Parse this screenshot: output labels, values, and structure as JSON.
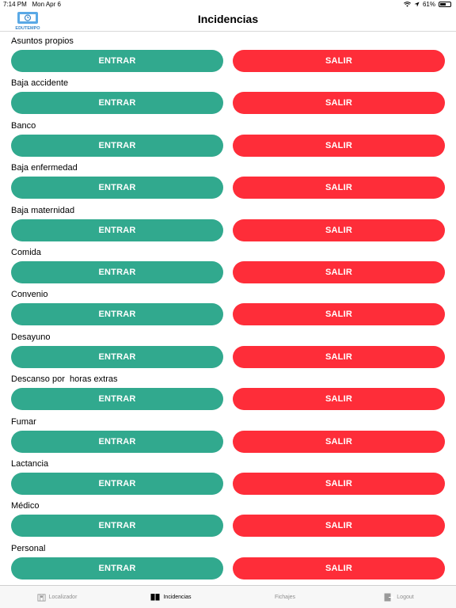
{
  "status_bar": {
    "time": "7:14 PM",
    "date": "Mon Apr 6",
    "battery": "61%",
    "battery_level": 0.61
  },
  "nav": {
    "title": "Incidencias",
    "logo_text": "EDUTEMPO"
  },
  "colors": {
    "entrar": "#31a98e",
    "salir": "#fe2d39"
  },
  "incidencias": [
    {
      "label": "Asuntos propios",
      "entrar": "ENTRAR",
      "salir": "SALIR"
    },
    {
      "label": "Baja accidente",
      "entrar": "ENTRAR",
      "salir": "SALIR"
    },
    {
      "label": "Banco",
      "entrar": "ENTRAR",
      "salir": "SALIR"
    },
    {
      "label": "Baja enfermedad",
      "entrar": "ENTRAR",
      "salir": "SALIR"
    },
    {
      "label": "Baja maternidad",
      "entrar": "ENTRAR",
      "salir": "SALIR"
    },
    {
      "label": "Comida",
      "entrar": "ENTRAR",
      "salir": "SALIR"
    },
    {
      "label": "Convenio",
      "entrar": "ENTRAR",
      "salir": "SALIR"
    },
    {
      "label": "Desayuno",
      "entrar": "ENTRAR",
      "salir": "SALIR"
    },
    {
      "label": "Descanso por  horas extras",
      "entrar": "ENTRAR",
      "salir": "SALIR"
    },
    {
      "label": "Fumar",
      "entrar": "ENTRAR",
      "salir": "SALIR"
    },
    {
      "label": "Lactancia",
      "entrar": "ENTRAR",
      "salir": "SALIR"
    },
    {
      "label": "Médico",
      "entrar": "ENTRAR",
      "salir": "SALIR"
    },
    {
      "label": "Personal",
      "entrar": "ENTRAR",
      "salir": "SALIR"
    }
  ],
  "tabs": [
    {
      "label": "Localizador",
      "icon": "map-icon",
      "active": false
    },
    {
      "label": "Incidencias",
      "icon": "book-icon",
      "active": true
    },
    {
      "label": "Fichajes",
      "icon": "",
      "active": false
    },
    {
      "label": "Logout",
      "icon": "logout-icon",
      "active": false
    }
  ]
}
